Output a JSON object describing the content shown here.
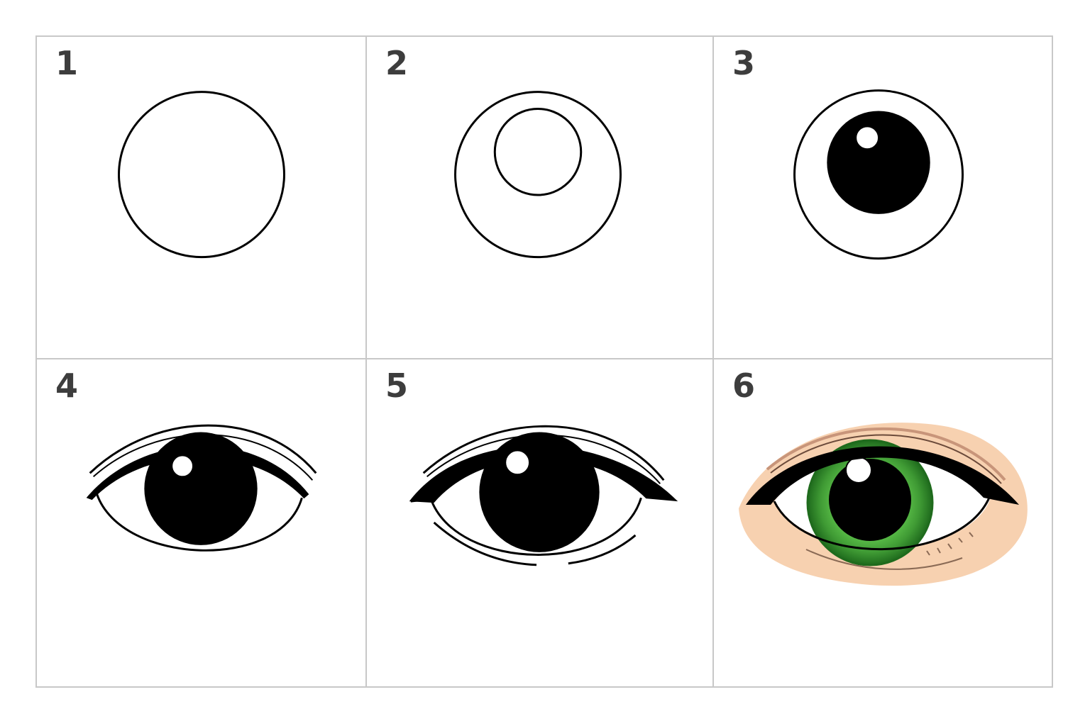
{
  "steps": [
    {
      "number": "1"
    },
    {
      "number": "2"
    },
    {
      "number": "3"
    },
    {
      "number": "4"
    },
    {
      "number": "5"
    },
    {
      "number": "6"
    }
  ],
  "colors": {
    "line": "#000000",
    "pupil": "#000000",
    "iris": "#3f9a34",
    "iris_dark": "#1f6b1d",
    "skin": "#f7d1b0",
    "skin_shadow": "#c8957a",
    "border": "#c8c8c8",
    "number": "#3d3d3d"
  }
}
